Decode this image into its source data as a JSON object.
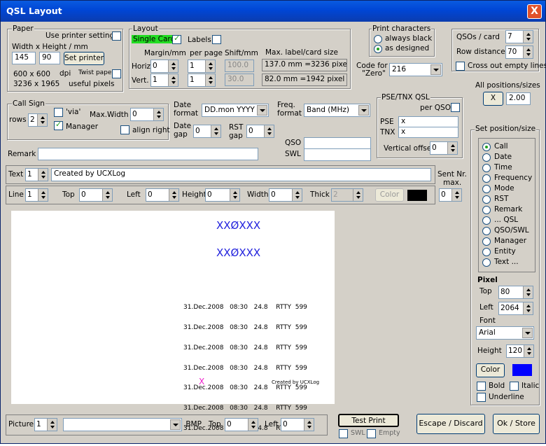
{
  "window": {
    "title": "QSL Layout",
    "close": "X"
  },
  "paper": {
    "title": "Paper",
    "use_printer": "Use printer settings",
    "wh_label": "Width x Height / mm",
    "width": "145",
    "height": "90",
    "set_printer": "Set printer",
    "dpi_value": "600 x 600",
    "dpi": "dpi",
    "twist": "Twist paper",
    "pixels": "3236 x 1965",
    "useful": "useful pixels"
  },
  "layout": {
    "title": "Layout",
    "single_card": "Single Card",
    "labels": "Labels",
    "margin": "Margin/mm",
    "per_page": "per page",
    "shift": "Shift/mm",
    "horiz": "Horiz.",
    "vert": "Vert.",
    "h_margin": "0",
    "v_margin": "1",
    "h_per": "1",
    "v_per": "1",
    "h_shift": "100.0",
    "v_shift": "30.0",
    "max_label": "Max. label/card size",
    "mm1": "137.0 mm",
    "px1": "=3236 pixel",
    "mm2": "82.0 mm",
    "px2": "=1942 pixel"
  },
  "print_chars": {
    "title": "Print characters",
    "opt1": "always black",
    "opt2": "as designed"
  },
  "code_zero": {
    "label1": "Code for",
    "label2": "\"Zero\"",
    "value": "216"
  },
  "qsos": {
    "per_card": "QSOs / card",
    "per_card_val": "7",
    "row_dist": "Row distance",
    "row_dist_val": "70",
    "cross": "Cross out empty lines"
  },
  "all_pos": {
    "label": "All positions/sizes",
    "btn": "X",
    "value": "2.00"
  },
  "callsign": {
    "title": "Call Sign",
    "rows": "rows",
    "rows_val": "2",
    "via": "'via'",
    "manager": "Manager",
    "max_width": "Max.Width",
    "max_width_val": "0",
    "align_right": "align right"
  },
  "date": {
    "format_label1": "Date",
    "format_label2": "format",
    "format_val": "DD.mon YYYY",
    "gap1": "Date",
    "gap2": "gap",
    "gap_val": "0",
    "rst1": "RST",
    "rst2": "gap",
    "rst_val": "0"
  },
  "freq": {
    "label1": "Freq.",
    "label2": "format",
    "value": "Band (MHz)"
  },
  "pse": {
    "title": "PSE/TNX QSL",
    "per_qso": "per QSO",
    "pse": "PSE",
    "pse_val": "x",
    "tnx": "TNX",
    "tnx_val": "x",
    "voffset": "Vertical offset",
    "voffset_val": "0"
  },
  "qso_label": "QSO",
  "swl_label": "SWL",
  "remark_label": "Remark",
  "text_row": {
    "label": "Text",
    "num": "1",
    "value": "Created by UCXLog"
  },
  "sent_nr": {
    "label1": "Sent Nr.",
    "label2": "max.",
    "value": "0"
  },
  "line_row": {
    "line": "Line",
    "line_val": "1",
    "top": "Top",
    "top_val": "0",
    "left": "Left",
    "left_val": "0",
    "height": "Height",
    "height_val": "0",
    "width": "Width",
    "width_val": "0",
    "thick": "Thick",
    "thick_val": "2",
    "color": "Color"
  },
  "preview": {
    "call1": "XXØXXX",
    "call2": "XXØXXX",
    "lines": [
      "31.Dec.2008   08:30   24.8    RTTY  599",
      "31.Dec.2008   08:30   24.8    RTTY  599",
      "31.Dec.2008   08:30   24.8    RTTY  599",
      "31.Dec.2008   08:30   24.8    RTTY  599",
      "31.Dec.2008   08:30   24.8    RTTY  599",
      "31.Dec.2008   08:30   24.8    RTTY  599",
      "31.Dec.2008   08:30   24.8    RTTY  599"
    ],
    "x_mark": "X",
    "created": "Created by UCXLog"
  },
  "setpos": {
    "title": "Set position/size",
    "options": [
      "Call",
      "Date",
      "Time",
      "Frequency",
      "Mode",
      "RST",
      "Remark",
      "... QSL",
      "QSO/SWL",
      "Manager",
      "Entity",
      "Text ..."
    ],
    "pixel": "Pixel",
    "top": "Top",
    "top_val": "80",
    "left": "Left",
    "left_val": "2064",
    "font": "Font",
    "font_val": "Arial",
    "height": "Height",
    "height_val": "120",
    "color": "Color",
    "bold": "Bold",
    "italic": "Italic",
    "underline": "Underline",
    "font_color": "#0000ff"
  },
  "bottom": {
    "picture": "Picture",
    "pic_num": "1",
    "bmp": ".BMP",
    "top": "Top",
    "top_val": "0",
    "left": "Left",
    "left_val": "0",
    "test_print": "Test Print",
    "swl": "SWL",
    "empty": "Empty",
    "escape": "Escape / Discard",
    "ok": "Ok / Store"
  }
}
